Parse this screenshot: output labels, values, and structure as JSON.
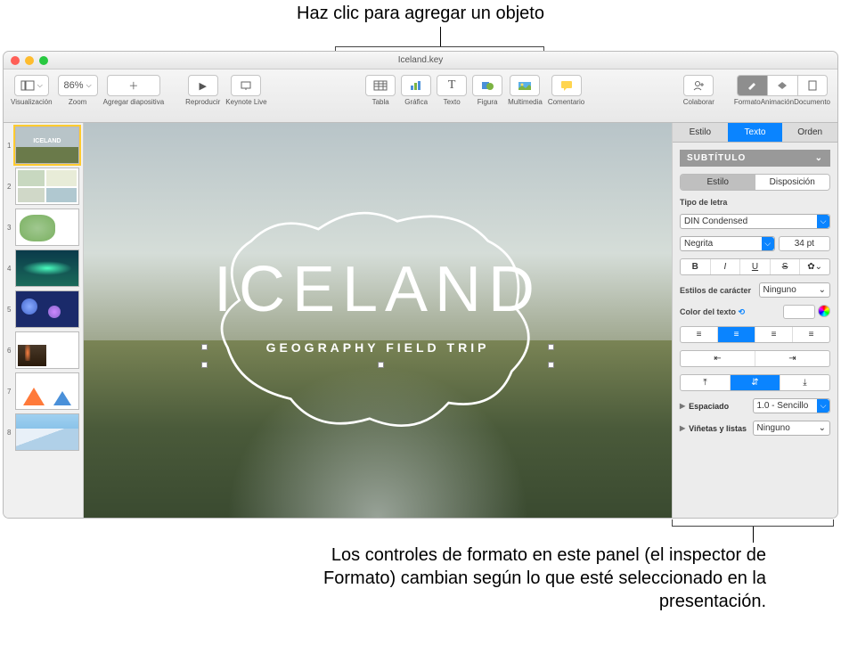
{
  "annotations": {
    "top": "Haz clic para agregar un objeto",
    "bottom": "Los controles de formato en este panel (el inspector de Formato) cambian según lo que esté seleccionado en la presentación."
  },
  "window": {
    "title": "Iceland.key"
  },
  "toolbar": {
    "view": "Visualización",
    "zoom": "Zoom",
    "zoom_value": "86%",
    "add_slide": "Agregar diapositiva",
    "play": "Reproducir",
    "keynote_live": "Keynote Live",
    "table": "Tabla",
    "chart": "Gráfica",
    "text": "Texto",
    "shape": "Figura",
    "media": "Multimedia",
    "comment": "Comentario",
    "collaborate": "Colaborar",
    "format": "Formato",
    "animate": "Animación",
    "document": "Documento"
  },
  "navigator": {
    "slides": [
      1,
      2,
      3,
      4,
      5,
      6,
      7,
      8
    ]
  },
  "canvas": {
    "headline": "ICELAND",
    "subline": "GEOGRAPHY FIELD TRIP"
  },
  "inspector": {
    "tabs": {
      "style": "Estilo",
      "text": "Texto",
      "order": "Orden"
    },
    "paragraph_style": "SUBTÍTULO",
    "subtabs": {
      "style": "Estilo",
      "layout": "Disposición"
    },
    "font_section": "Tipo de letra",
    "font_family": "DIN Condensed",
    "font_weight": "Negrita",
    "font_size": "34 pt",
    "bold": "B",
    "italic": "I",
    "underline": "U",
    "strike": "S",
    "char_styles_label": "Estilos de carácter",
    "char_styles_value": "Ninguno",
    "text_color_label": "Color del texto",
    "spacing_label": "Espaciado",
    "spacing_value": "1.0 - Sencillo",
    "bullets_label": "Viñetas y listas",
    "bullets_value": "Ninguno"
  }
}
